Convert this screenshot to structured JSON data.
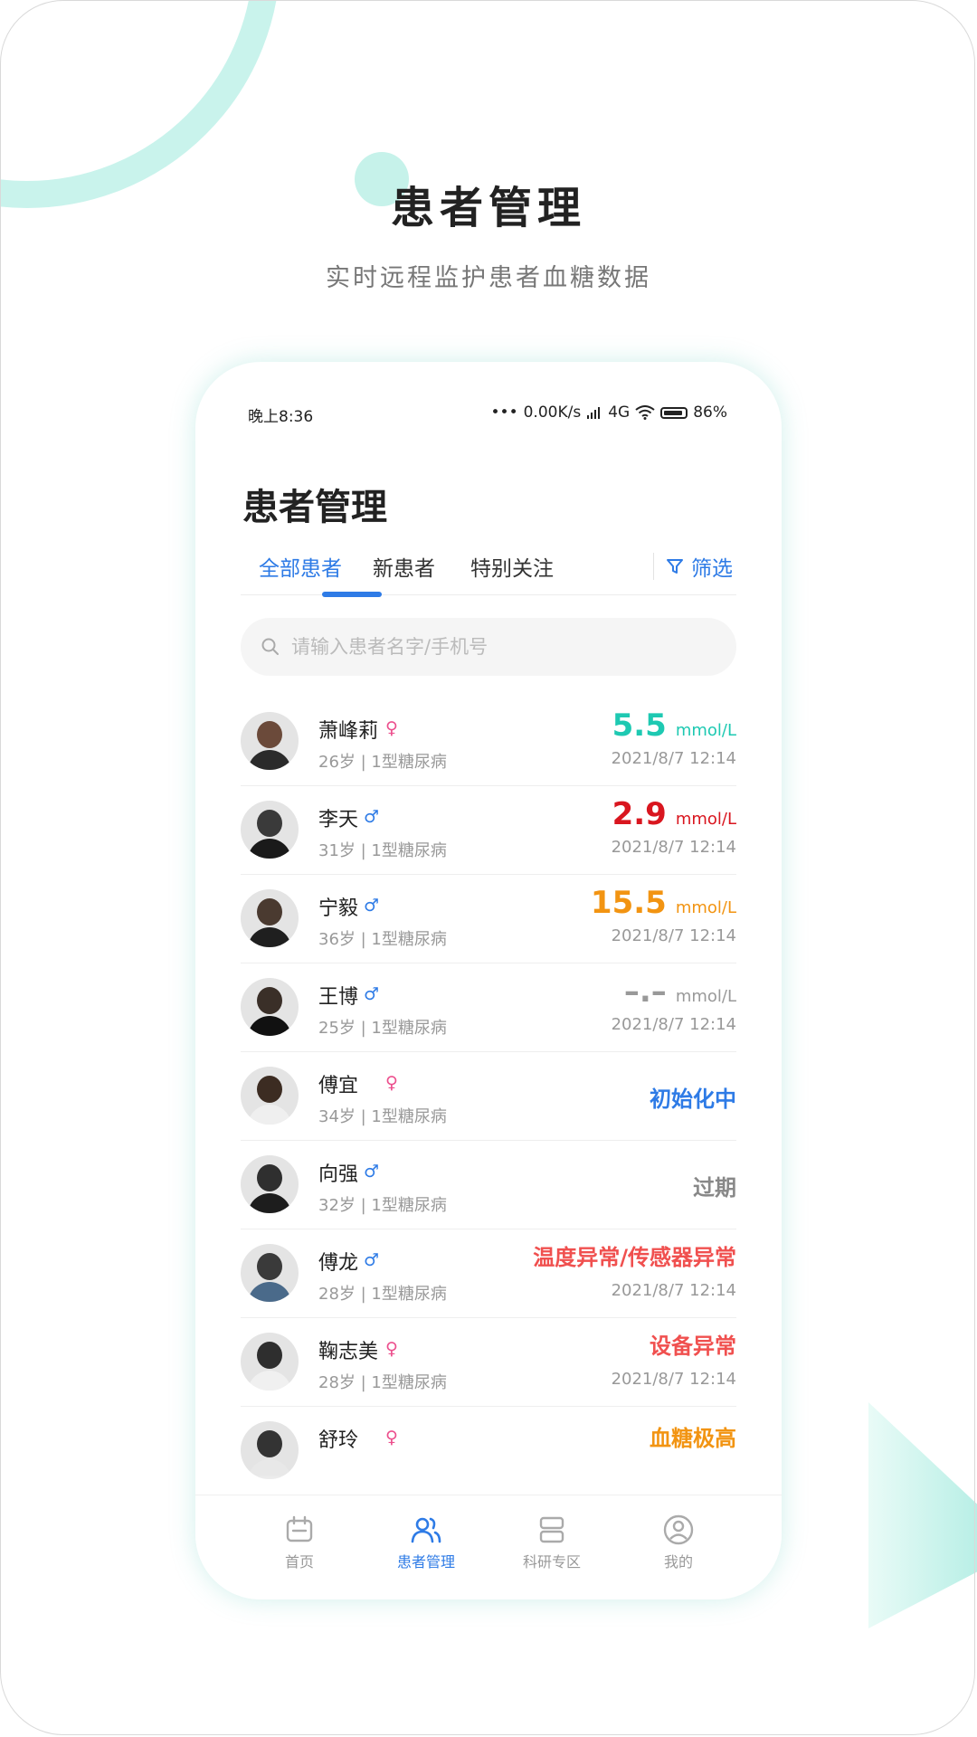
{
  "hero": {
    "title": "患者管理",
    "subtitle": "实时远程监护患者血糖数据"
  },
  "status_bar": {
    "time": "晚上8:36",
    "network_speed": "0.00K/s",
    "network_type": "4G",
    "battery": "86%"
  },
  "app": {
    "title": "患者管理"
  },
  "tabs": [
    {
      "label": "全部患者",
      "active": true
    },
    {
      "label": "新患者",
      "active": false
    },
    {
      "label": "特别关注",
      "active": false
    }
  ],
  "filter": {
    "label": "筛选",
    "icon": "filter-icon"
  },
  "search": {
    "placeholder": "请输入患者名字/手机号",
    "icon": "search-icon"
  },
  "patients": [
    {
      "name": "萧峰莉",
      "gender": "female",
      "meta": "26岁 | 1型糖尿病",
      "value": "5.5",
      "unit": "mmol/L",
      "time": "2021/8/7 12:14",
      "color": "#1ec9b2"
    },
    {
      "name": "李天",
      "gender": "male",
      "meta": "31岁 | 1型糖尿病",
      "value": "2.9",
      "unit": "mmol/L",
      "time": "2021/8/7 12:14",
      "color": "#d9161f"
    },
    {
      "name": "宁毅",
      "gender": "male",
      "meta": "36岁 | 1型糖尿病",
      "value": "15.5",
      "unit": "mmol/L",
      "time": "2021/8/7 12:14",
      "color": "#f29412"
    },
    {
      "name": "王博",
      "gender": "male",
      "meta": "25岁 | 1型糖尿病",
      "value": "–.–",
      "unit": "mmol/L",
      "time": "2021/8/7 12:14",
      "color": "#999999"
    },
    {
      "name": "傅宜",
      "gender": "female",
      "meta": "34岁 | 1型糖尿病",
      "status": "初始化中",
      "color": "#2e7be6"
    },
    {
      "name": "向强",
      "gender": "male",
      "meta": "32岁 | 1型糖尿病",
      "status": "过期",
      "color": "#888888"
    },
    {
      "name": "傅龙",
      "gender": "male",
      "meta": "28岁 | 1型糖尿病",
      "status": "温度异常/传感器异常",
      "time": "2021/8/7 12:14",
      "color": "#f0504f"
    },
    {
      "name": "鞠志美",
      "gender": "female",
      "meta": "28岁 | 1型糖尿病",
      "status": "设备异常",
      "time": "2021/8/7 12:14",
      "color": "#f0504f"
    },
    {
      "name": "舒玲",
      "gender": "female",
      "status": "血糖极高",
      "color": "#f29412"
    }
  ],
  "tabbar": [
    {
      "label": "首页",
      "icon": "home-icon",
      "active": false
    },
    {
      "label": "患者管理",
      "icon": "patients-icon",
      "active": true
    },
    {
      "label": "科研专区",
      "icon": "research-icon",
      "active": false
    },
    {
      "label": "我的",
      "icon": "profile-icon",
      "active": false
    }
  ],
  "colors": {
    "accent": "#2e7be6",
    "female": "#ec4f8d",
    "male": "#2e7be6",
    "decor": "#c9f3ec"
  }
}
